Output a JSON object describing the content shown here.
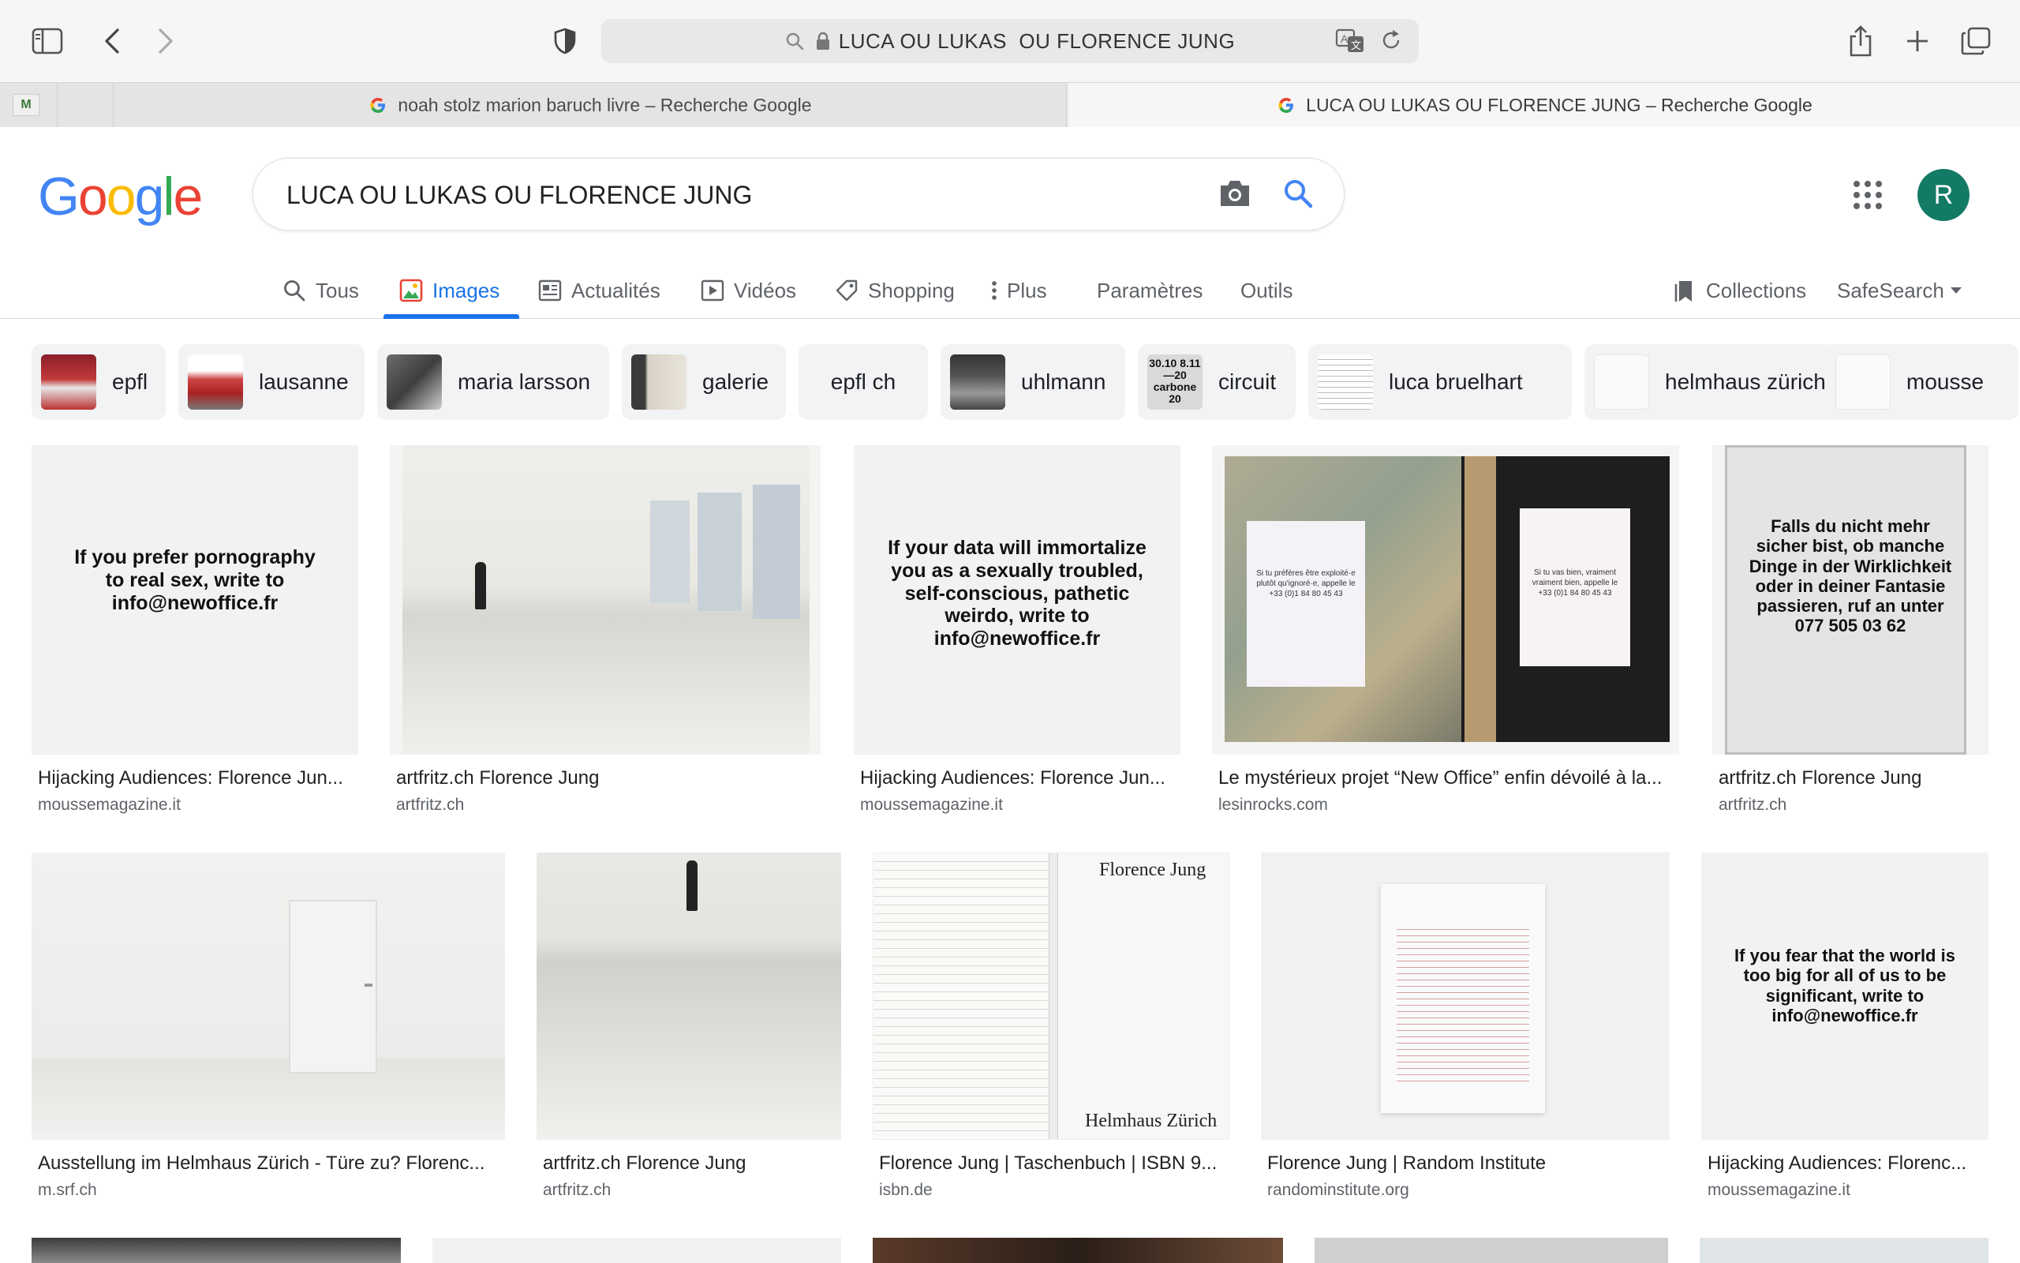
{
  "browser": {
    "url": "LUCA OU LUKAS  OU FLORENCE JUNG",
    "pinned_tab_label": "M",
    "tabs": [
      {
        "title": "noah stolz marion baruch livre – Recherche Google",
        "active": false
      },
      {
        "title": "LUCA OU LUKAS OU FLORENCE JUNG – Recherche Google",
        "active": true
      }
    ]
  },
  "google": {
    "logo": "Google",
    "query": "LUCA OU LUKAS OU FLORENCE JUNG",
    "avatar_letter": "R"
  },
  "nav": {
    "tabs": [
      "Tous",
      "Images",
      "Actualités",
      "Vidéos",
      "Shopping",
      "Plus",
      "Paramètres",
      "Outils"
    ],
    "active": "Images",
    "collections": "Collections",
    "safesearch": "SafeSearch"
  },
  "chips": [
    "epfl",
    "lausanne",
    "maria larsson",
    "galerie",
    "epfl ch",
    "uhlmann",
    "circuit",
    "luca bruelhart",
    "helmhaus zürich",
    "mousse"
  ],
  "chip_thumb_texts": {
    "circuit": "30.10 8.11—20 carbone 20"
  },
  "results_row1": [
    {
      "title": "Hijacking Audiences: Florence Jun...",
      "source": "moussemagazine.it",
      "poster": "If you prefer pornography to real sex, write to info@newoffice.fr"
    },
    {
      "title": "artfritz.ch Florence Jung",
      "source": "artfritz.ch"
    },
    {
      "title": "Hijacking Audiences: Florence Jun...",
      "source": "moussemagazine.it",
      "poster": "If your data will immortalize you as a sexually troubled, self-conscious, pathetic weirdo, write to info@newoffice.fr"
    },
    {
      "title": "Le mystérieux projet “New Office” enfin dévoilé à la...",
      "source": "lesinrocks.com",
      "notes": [
        "Si tu préfères être exploité·e plutôt qu'ignoré·e, appelle le +33 (0)1 84 80 45 43",
        "Si tu vas bien, vraiment vraiment bien, appelle le +33 (0)1 84 80 45 43"
      ]
    },
    {
      "title": "artfritz.ch Florence Jung",
      "source": "artfritz.ch",
      "poster": "Falls du nicht mehr sicher bist, ob manche Dinge in der Wirklichkeit oder in deiner Fantasie passieren, ruf an unter 077 505 03 62"
    }
  ],
  "results_row2": [
    {
      "title": "Ausstellung im Helmhaus Zürich - Türe zu? Florenc...",
      "source": "m.srf.ch"
    },
    {
      "title": "artfritz.ch Florence Jung",
      "source": "artfritz.ch"
    },
    {
      "title": "Florence Jung | Taschenbuch | ISBN 9...",
      "source": "isbn.de",
      "book_title": "Florence Jung",
      "book_subtitle": "Helmhaus Zürich"
    },
    {
      "title": "Florence Jung | Random Institute",
      "source": "randominstitute.org"
    },
    {
      "title": "Hijacking Audiences: Florenc...",
      "source": "moussemagazine.it",
      "poster": "If you fear that the world is too big for all of us to be significant, write to info@newoffice.fr"
    }
  ],
  "colors": {
    "google_blue": "#4285F4",
    "google_red": "#EA4335",
    "google_yellow": "#FBBC05",
    "google_green": "#34A853",
    "active_tab": "#1a73e8",
    "avatar_bg": "#137a66"
  }
}
